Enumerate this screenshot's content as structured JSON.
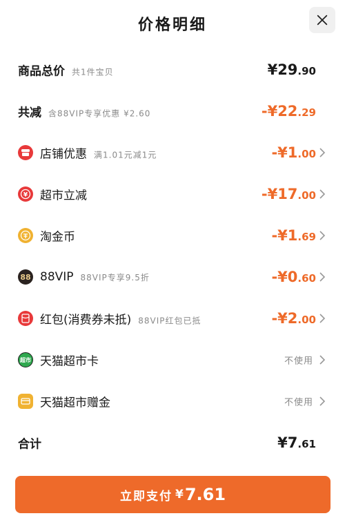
{
  "header": {
    "title": "价格明细"
  },
  "rows": [
    {
      "label": "商品总价",
      "sub": "共1件宝贝",
      "currency": "¥",
      "amount_int": "29",
      "amount_dec": ".90"
    },
    {
      "label": "共减",
      "sub": "含88VIP专享优惠 ¥2.60",
      "currency": "-¥",
      "amount_int": "22",
      "amount_dec": ".29"
    },
    {
      "label": "店铺优惠",
      "sub": "满1.01元减1元",
      "currency": "-¥",
      "amount_int": "1",
      "amount_dec": ".00",
      "icon": "store-discount-icon"
    },
    {
      "label": "超市立减",
      "sub": "",
      "currency": "-¥",
      "amount_int": "17",
      "amount_dec": ".00",
      "icon": "supermarket-discount-icon"
    },
    {
      "label": "淘金币",
      "sub": "",
      "currency": "-¥",
      "amount_int": "1",
      "amount_dec": ".69",
      "icon": "gold-coin-icon"
    },
    {
      "label": "88VIP",
      "sub": "88VIP专享9.5折",
      "currency": "-¥",
      "amount_int": "0",
      "amount_dec": ".60",
      "icon": "88vip-icon",
      "icon_text": "88"
    },
    {
      "label": "红包(消费券未抵)",
      "sub": "88VIP红包已抵",
      "currency": "-¥",
      "amount_int": "2",
      "amount_dec": ".00",
      "icon": "red-packet-icon"
    },
    {
      "label": "天猫超市卡",
      "sub": "",
      "status": "不使用",
      "icon": "tmall-card-icon",
      "icon_text": "超市"
    },
    {
      "label": "天猫超市赠金",
      "sub": "",
      "status": "不使用",
      "icon": "gift-money-icon"
    },
    {
      "label": "合计",
      "sub": "",
      "currency": "¥",
      "amount_int": "7",
      "amount_dec": ".61"
    }
  ],
  "pay_button": {
    "label": "立即支付",
    "currency": "¥",
    "amount": "7.61"
  },
  "colors": {
    "accent": "#ee6a2a",
    "red": "#e8393a",
    "gold": "#f0b232",
    "dark": "#2b2320",
    "green": "#2fa84f"
  }
}
